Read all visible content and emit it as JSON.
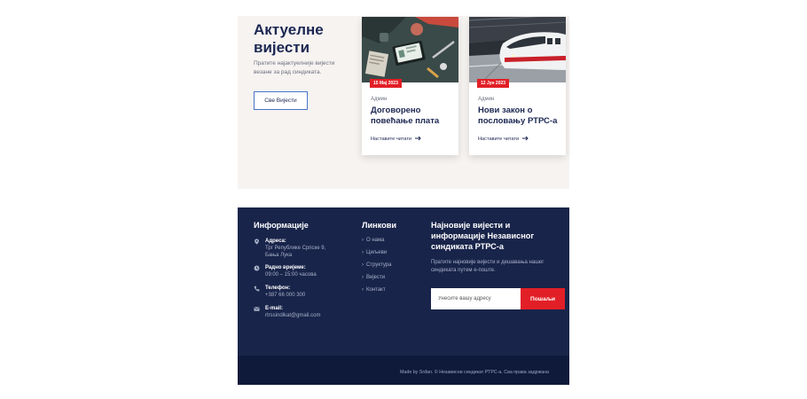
{
  "news": {
    "title": "Актуелне вијести",
    "subtitle": "Пратите најактуелније вијести везане за рад синдиката.",
    "all_button": "Све Вијести",
    "cards": [
      {
        "date": "15 Мај 2023",
        "category": "Админ",
        "title": "Договорено повећање плата",
        "read_more": "Наставите читати"
      },
      {
        "date": "12 Јун 2023",
        "category": "Админ",
        "title": "Нови закон о пословању РТРС-а",
        "read_more": "Наставите читати"
      }
    ]
  },
  "footer": {
    "info_heading": "Информације",
    "info": [
      {
        "icon": "map-pin-icon",
        "label": "Адреса:",
        "value": "Трг Републике Српске 9, Бања Лука"
      },
      {
        "icon": "clock-icon",
        "label": "Радно вријеме:",
        "value": "09:00 – 15:00 часова"
      },
      {
        "icon": "phone-icon",
        "label": "Телефон:",
        "value": "+387 66 000 300"
      },
      {
        "icon": "mail-icon",
        "label": "E-mail:",
        "value": "rtrssindikat@gmail.com"
      }
    ],
    "links_heading": "Линкови",
    "links": [
      "О нама",
      "Циљеви",
      "Структура",
      "Вијести",
      "Контакт"
    ],
    "newsletter_heading": "Најновије вијести и информације Независног синдиката РТРС-а",
    "newsletter_text": "Пратите најновије вијести и дешавања нашег синдиката путем е-поште.",
    "email_placeholder": "Унесите вашу адресу",
    "send_button": "Пошаљи",
    "copyright": "Made by Srđan. © Независни синдикат РТРС-а. Сва права задржана"
  },
  "colors": {
    "navy": "#19244a",
    "navy_dark": "#0f1a3b",
    "accent_red": "#e21f26",
    "heading": "#1c2752"
  }
}
